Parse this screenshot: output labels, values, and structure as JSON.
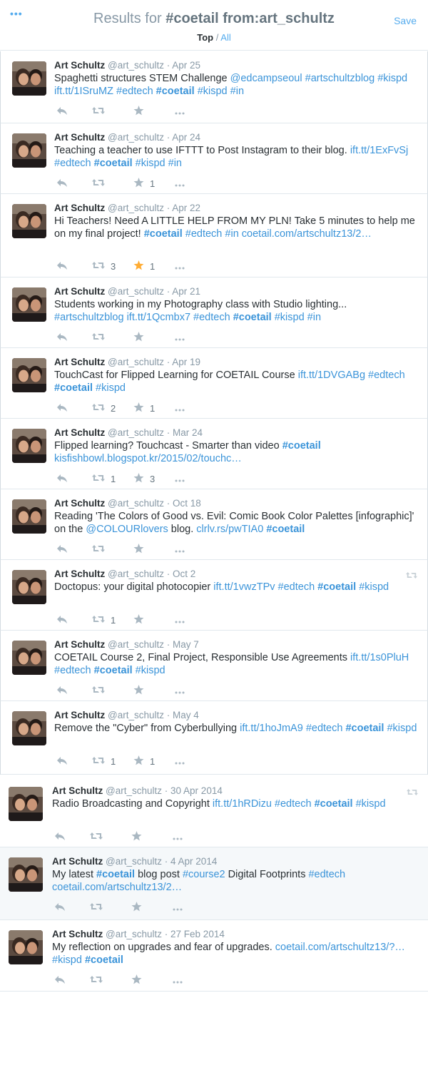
{
  "header": {
    "menu_icon": "more-dots-icon",
    "title_prefix": "Results for",
    "title_query": "#coetail from:art_schultz",
    "save_label": "Save",
    "tab_top": "Top",
    "tab_separator": "/",
    "tab_all": "All"
  },
  "colors": {
    "link": "#3b94d9",
    "accent": "#55acee",
    "muted": "#8899a6",
    "favorited_star": "#ffac33"
  },
  "tweets": [
    {
      "name": "Art Schultz",
      "handle": "@art_schultz",
      "date": "· Apr 25",
      "parts": [
        {
          "t": "Spaghetti structures STEM Challenge "
        },
        {
          "t": "@edcampseoul",
          "link": true
        },
        {
          "t": " "
        },
        {
          "t": "#artschultzblog",
          "link": true
        },
        {
          "t": " "
        },
        {
          "t": "#kispd",
          "link": true
        },
        {
          "t": " "
        },
        {
          "t": "ift.tt/1ISruMZ",
          "link": true
        },
        {
          "t": " "
        },
        {
          "t": "#edtech",
          "link": true
        },
        {
          "t": " "
        },
        {
          "t": "#coetail",
          "link": true,
          "bold": true
        },
        {
          "t": " "
        },
        {
          "t": "#kispd",
          "link": true
        },
        {
          "t": " "
        },
        {
          "t": "#in",
          "link": true
        }
      ],
      "retweets": "",
      "favorites": "",
      "favorited": false,
      "retweet_flag": false
    },
    {
      "name": "Art Schultz",
      "handle": "@art_schultz",
      "date": "· Apr 24",
      "parts": [
        {
          "t": "Teaching a teacher to use IFTTT to Post Instagram to their blog. "
        },
        {
          "t": "ift.tt/1ExFvSj",
          "link": true
        },
        {
          "t": " "
        },
        {
          "t": "#edtech",
          "link": true
        },
        {
          "t": " "
        },
        {
          "t": "#coetail",
          "link": true,
          "bold": true
        },
        {
          "t": " "
        },
        {
          "t": "#kispd",
          "link": true
        },
        {
          "t": " "
        },
        {
          "t": "#in",
          "link": true
        }
      ],
      "retweets": "",
      "favorites": "1",
      "favorited": false,
      "retweet_flag": false
    },
    {
      "name": "Art Schultz",
      "handle": "@art_schultz",
      "date": "· Apr 22",
      "parts": [
        {
          "t": "Hi Teachers!  Need A LITTLE HELP FROM MY PLN! Take 5 minutes to help me on my final project!  "
        },
        {
          "t": "#coetail",
          "link": true,
          "bold": true
        },
        {
          "t": " "
        },
        {
          "t": "#edtech",
          "link": true
        },
        {
          "t": " "
        },
        {
          "t": "#in",
          "link": true
        },
        {
          "t": " "
        },
        {
          "t": "coetail.com/artschultz13/2…",
          "link": true
        }
      ],
      "retweets": "3",
      "favorites": "1",
      "favorited": true,
      "retweet_flag": false
    },
    {
      "name": "Art Schultz",
      "handle": "@art_schultz",
      "date": "· Apr 21",
      "parts": [
        {
          "t": "Students working in my Photography class with Studio lighting... "
        },
        {
          "t": "#artschultzblog",
          "link": true
        },
        {
          "t": " "
        },
        {
          "t": "ift.tt/1Qcmbx7",
          "link": true
        },
        {
          "t": " "
        },
        {
          "t": "#edtech",
          "link": true
        },
        {
          "t": " "
        },
        {
          "t": "#coetail",
          "link": true,
          "bold": true
        },
        {
          "t": " "
        },
        {
          "t": "#kispd",
          "link": true
        },
        {
          "t": " "
        },
        {
          "t": "#in",
          "link": true
        }
      ],
      "retweets": "",
      "favorites": "",
      "favorited": false,
      "retweet_flag": false
    },
    {
      "name": "Art Schultz",
      "handle": "@art_schultz",
      "date": "· Apr 19",
      "parts": [
        {
          "t": "TouchCast for Flipped Learning for COETAIL Course "
        },
        {
          "t": "ift.tt/1DVGABg",
          "link": true
        },
        {
          "t": " "
        },
        {
          "t": "#edtech",
          "link": true
        },
        {
          "t": " "
        },
        {
          "t": "#coetail",
          "link": true,
          "bold": true
        },
        {
          "t": " "
        },
        {
          "t": "#kispd",
          "link": true
        }
      ],
      "retweets": "2",
      "favorites": "1",
      "favorited": false,
      "retweet_flag": false
    },
    {
      "name": "Art Schultz",
      "handle": "@art_schultz",
      "date": "· Mar 24",
      "parts": [
        {
          "t": "Flipped learning?  Touchcast - Smarter than video "
        },
        {
          "t": "#coetail",
          "link": true,
          "bold": true
        },
        {
          "t": " "
        },
        {
          "t": "kisfishbowl.blogspot.kr/2015/02/touchc…",
          "link": true
        }
      ],
      "retweets": "1",
      "favorites": "3",
      "favorited": false,
      "retweet_flag": false
    },
    {
      "name": "Art Schultz",
      "handle": "@art_schultz",
      "date": "· Oct 18",
      "parts": [
        {
          "t": "Reading 'The Colors of Good vs. Evil: Comic Book Color Palettes [infographic]' on the "
        },
        {
          "t": "@COLOURlovers",
          "link": true
        },
        {
          "t": " blog. "
        },
        {
          "t": "clrlv.rs/pwTIA0",
          "link": true
        },
        {
          "t": " "
        },
        {
          "t": "#coetail",
          "link": true,
          "bold": true
        }
      ],
      "retweets": "",
      "favorites": "",
      "favorited": false,
      "retweet_flag": false
    },
    {
      "name": "Art Schultz",
      "handle": "@art_schultz",
      "date": "· Oct 2",
      "parts": [
        {
          "t": "Doctopus: your digital photocopier "
        },
        {
          "t": "ift.tt/1vwzTPv",
          "link": true
        },
        {
          "t": " "
        },
        {
          "t": "#edtech",
          "link": true
        },
        {
          "t": " "
        },
        {
          "t": "#coetail",
          "link": true,
          "bold": true
        },
        {
          "t": " "
        },
        {
          "t": "#kispd",
          "link": true
        }
      ],
      "retweets": "1",
      "favorites": "",
      "favorited": false,
      "retweet_flag": true
    },
    {
      "name": "Art Schultz",
      "handle": "@art_schultz",
      "date": "· May 7",
      "parts": [
        {
          "t": "COETAIL Course 2, Final Project, Responsible Use Agreements "
        },
        {
          "t": "ift.tt/1s0PluH",
          "link": true
        },
        {
          "t": " "
        },
        {
          "t": "#edtech",
          "link": true
        },
        {
          "t": " "
        },
        {
          "t": "#coetail",
          "link": true,
          "bold": true
        },
        {
          "t": " "
        },
        {
          "t": "#kispd",
          "link": true
        }
      ],
      "retweets": "",
      "favorites": "",
      "favorited": false,
      "retweet_flag": false
    },
    {
      "name": "Art Schultz",
      "handle": "@art_schultz",
      "date": "· May 4",
      "parts": [
        {
          "t": "Remove the \"Cyber\" from Cyberbullying "
        },
        {
          "t": "ift.tt/1hoJmA9",
          "link": true
        },
        {
          "t": " "
        },
        {
          "t": "#edtech",
          "link": true
        },
        {
          "t": " "
        },
        {
          "t": "#coetail",
          "link": true,
          "bold": true
        },
        {
          "t": " "
        },
        {
          "t": "#kispd",
          "link": true
        }
      ],
      "retweets": "1",
      "favorites": "1",
      "favorited": false,
      "retweet_flag": false
    },
    {
      "name": "Art Schultz",
      "handle": "@art_schultz",
      "date": "· 30 Apr 2014",
      "parts": [
        {
          "t": "Radio Broadcasting and Copyright "
        },
        {
          "t": "ift.tt/1hRDizu",
          "link": true
        },
        {
          "t": " "
        },
        {
          "t": "#edtech",
          "link": true
        },
        {
          "t": " "
        },
        {
          "t": "#coetail",
          "link": true,
          "bold": true
        },
        {
          "t": " "
        },
        {
          "t": "#kispd",
          "link": true
        }
      ],
      "retweets": "",
      "favorites": "",
      "favorited": false,
      "retweet_flag": true
    },
    {
      "name": "Art Schultz",
      "handle": "@art_schultz",
      "date": "· 4 Apr 2014",
      "parts": [
        {
          "t": "My latest "
        },
        {
          "t": "#coetail",
          "link": true,
          "bold": true
        },
        {
          "t": " blog post "
        },
        {
          "t": "#course2",
          "link": true
        },
        {
          "t": " Digital Footprints "
        },
        {
          "t": "#edtech",
          "link": true
        },
        {
          "t": " "
        },
        {
          "t": "coetail.com/artschultz13/2…",
          "link": true
        }
      ],
      "retweets": "",
      "favorites": "",
      "favorited": false,
      "retweet_flag": false
    },
    {
      "name": "Art Schultz",
      "handle": "@art_schultz",
      "date": "· 27 Feb 2014",
      "parts": [
        {
          "t": "My reflection on upgrades and fear of upgrades. "
        },
        {
          "t": "coetail.com/artschultz13/?…",
          "link": true
        },
        {
          "t": " "
        },
        {
          "t": "#kispd",
          "link": true
        },
        {
          "t": " "
        },
        {
          "t": "#coetail",
          "link": true,
          "bold": true
        }
      ],
      "retweets": "",
      "favorites": "",
      "favorited": false,
      "retweet_flag": false
    }
  ]
}
